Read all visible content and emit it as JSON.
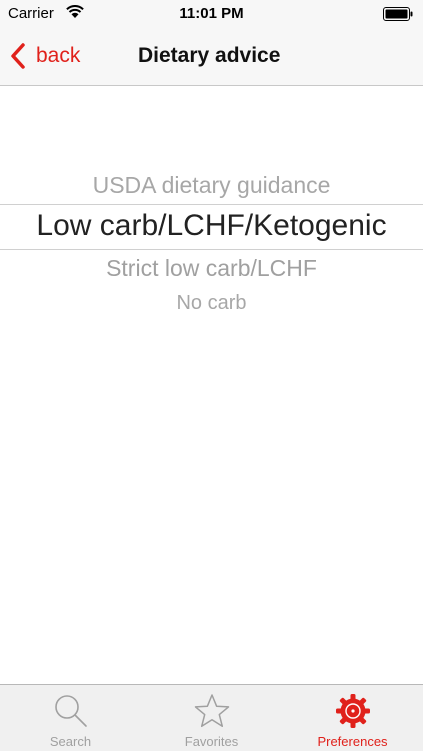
{
  "status_bar": {
    "carrier": "Carrier",
    "time": "11:01 PM"
  },
  "nav": {
    "back_label": "back",
    "title": "Dietary advice"
  },
  "picker": {
    "options": [
      "USDA dietary guidance",
      "Low carb/LCHF/Ketogenic",
      "Strict low carb/LCHF",
      "No carb"
    ],
    "selected_index": 1
  },
  "tab_bar": {
    "tabs": [
      {
        "label": "Search",
        "icon": "search-icon"
      },
      {
        "label": "Favorites",
        "icon": "star-icon"
      },
      {
        "label": "Preferences",
        "icon": "gear-icon"
      }
    ],
    "active_index": 2
  },
  "colors": {
    "accent": "#e0211b",
    "inactive": "#a0a0a0"
  }
}
